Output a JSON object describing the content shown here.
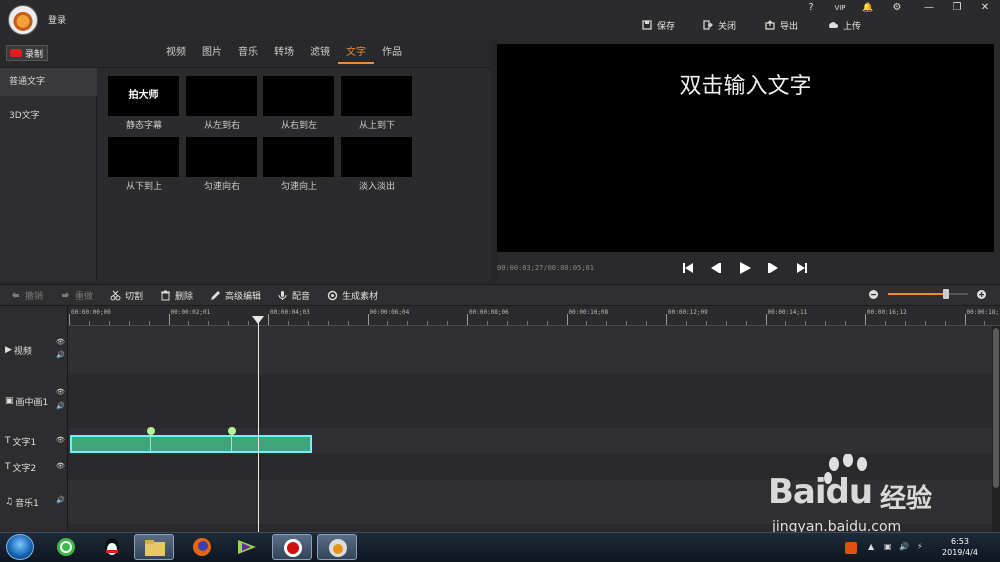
{
  "app": {
    "login": "登录",
    "top_icons": [
      "help-icon",
      "vip-icon",
      "bell-icon",
      "gear-icon",
      "minimize-icon",
      "restore-icon",
      "close-icon"
    ],
    "top_icon_glyphs": [
      "?",
      "VIP",
      "🔔",
      "⚙",
      "—",
      "❐",
      "✕"
    ],
    "actions": [
      {
        "label": "保存",
        "icon": "save-icon"
      },
      {
        "label": "关闭",
        "icon": "exit-icon"
      },
      {
        "label": "导出",
        "icon": "export-icon"
      },
      {
        "label": "上传",
        "icon": "upload-icon"
      }
    ]
  },
  "library": {
    "record_label": "录制",
    "tabs": [
      "视频",
      "图片",
      "音乐",
      "转场",
      "滤镜",
      "文字",
      "作品"
    ],
    "active_tab": 5,
    "side_items": [
      "普通文字",
      "3D文字"
    ],
    "active_side": 0,
    "effects": [
      {
        "thumb_text": "拍大师",
        "caption": "静态字幕"
      },
      {
        "thumb_text": "",
        "caption": "从左到右"
      },
      {
        "thumb_text": "",
        "caption": "从右到左"
      },
      {
        "thumb_text": "",
        "caption": "从上到下"
      },
      {
        "thumb_text": "",
        "caption": "从下到上"
      },
      {
        "thumb_text": "",
        "caption": "匀速向右"
      },
      {
        "thumb_text": "",
        "caption": "匀速向上"
      },
      {
        "thumb_text": "",
        "caption": "淡入淡出"
      }
    ]
  },
  "preview": {
    "overlay_text": "双击输入文字",
    "timecode": "00:00:03;27/00:00:05;01",
    "controls": [
      "skip-start-icon",
      "step-back-icon",
      "play-icon",
      "step-forward-icon",
      "skip-end-icon"
    ]
  },
  "toolbar": {
    "undo": "撤销",
    "redo": "重做",
    "cut": "切割",
    "delete": "删除",
    "advanced_edit": "高级编辑",
    "dubbing": "配音",
    "generate": "生成素材",
    "zoom_level": 0.72
  },
  "timeline": {
    "ruler_labels": [
      "00:00:00;00",
      "00:00:02;01",
      "00:00:04;03",
      "00:00:06;04",
      "00:00:08;06",
      "00:00:10;08",
      "00:00:12;09",
      "00:00:14;11",
      "00:00:16;12",
      "00:00:18;"
    ],
    "tracks": [
      {
        "label": "视频",
        "icon": "video-track-icon",
        "glyph": "▶",
        "controls": [
          "eye-icon",
          "speaker-icon"
        ]
      },
      {
        "label": "画中画1",
        "icon": "pip-track-icon",
        "glyph": "▣",
        "controls": [
          "eye-icon",
          "speaker-icon"
        ]
      },
      {
        "label": "文字1",
        "icon": "text-track-icon",
        "glyph": "T",
        "controls": [
          "eye-icon"
        ]
      },
      {
        "label": "文字2",
        "icon": "text-track-icon",
        "glyph": "T",
        "controls": [
          "eye-icon"
        ]
      },
      {
        "label": "音乐1",
        "icon": "music-track-icon",
        "glyph": "♫",
        "controls": [
          "speaker-icon"
        ]
      }
    ],
    "playhead_time": "00:00:03;27"
  },
  "taskbar": {
    "time": "6:53",
    "date": "2019/4/4",
    "apps": [
      "start-orb-icon",
      "browser-360-icon",
      "qq-icon",
      "file-explorer-icon",
      "firefox-icon",
      "player-icon",
      "record-app-icon",
      "paishi-app-icon"
    ]
  },
  "watermark": {
    "brand": "Bai",
    "brand2": "du",
    "cn": "经验",
    "url": "jingyan.baidu.com"
  }
}
